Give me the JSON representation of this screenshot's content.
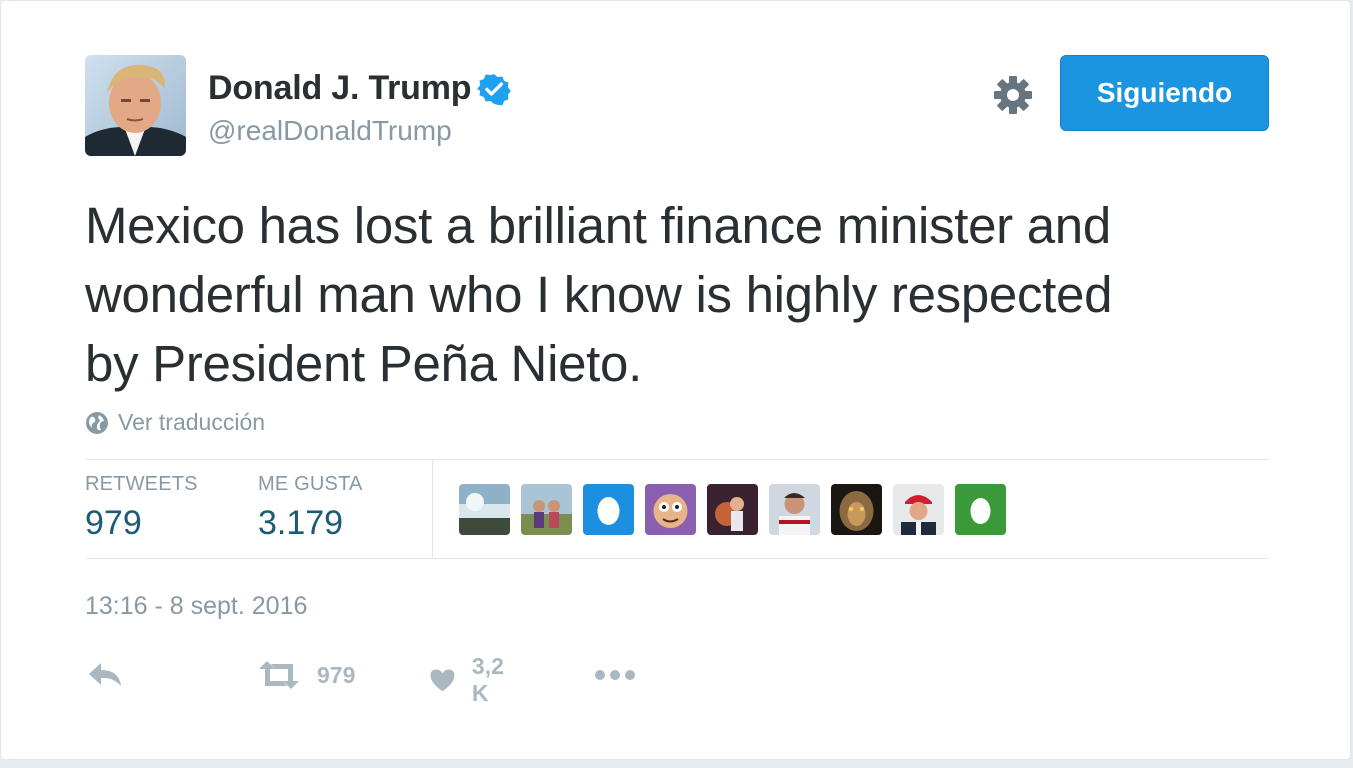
{
  "user": {
    "name": "Donald J. Trump",
    "handle": "@realDonaldTrump",
    "verified": true
  },
  "follow_button": {
    "label": "Siguiendo"
  },
  "tweet": {
    "text": "Mexico has lost a brilliant finance minister and\nwonderful man who I know is highly respected\nby President Peña Nieto."
  },
  "translate": {
    "label": "Ver traducción"
  },
  "stats": {
    "retweets_label": "RETWEETS",
    "retweets_value": "979",
    "likes_label": "ME GUSTA",
    "likes_value": "3.179"
  },
  "timestamp": "13:16 - 8 sept. 2016",
  "actions": {
    "retweet_count": "979",
    "like_count": "3,2 K"
  },
  "colors": {
    "accent": "#1b95e0",
    "muted": "#8899a6",
    "stat_value": "#1c5a7a",
    "action_icon": "#aab8c2"
  }
}
